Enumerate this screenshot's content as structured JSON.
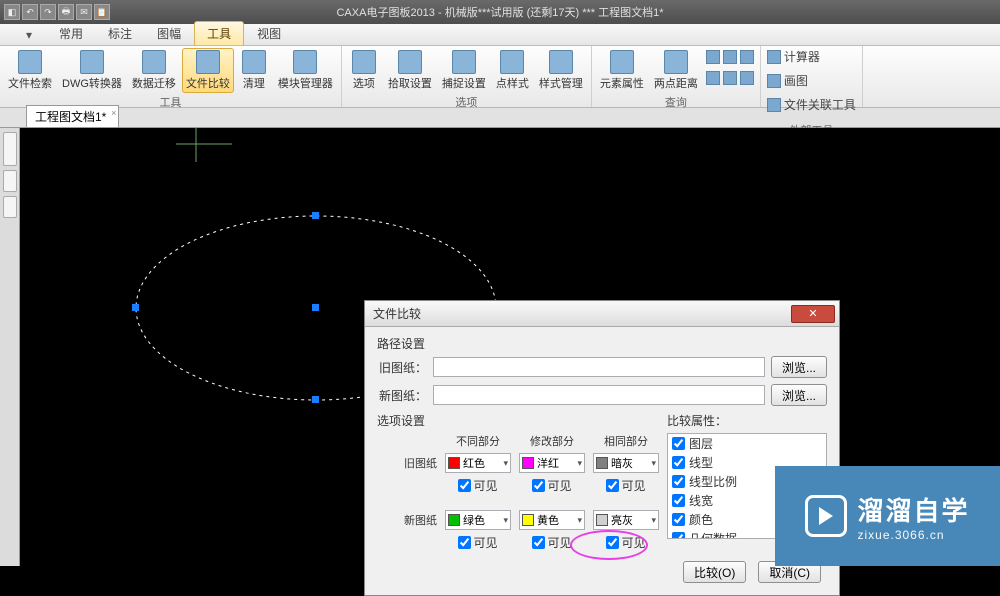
{
  "app": {
    "title": "CAXA电子图板2013 - 机械版***试用版 (还剩17天) ***   工程图文档1*"
  },
  "qat": [
    "↶",
    "↷",
    "🖶",
    "✉",
    "📋"
  ],
  "app_button": "◧",
  "tabs": {
    "items": [
      "常用",
      "标注",
      "图幅",
      "工具",
      "视图"
    ],
    "active_index": 3
  },
  "ribbon": {
    "groups": [
      {
        "label": "工具",
        "buttons": [
          {
            "label": "文件检索",
            "name": "file-search-button"
          },
          {
            "label": "DWG转换器",
            "name": "dwg-convert-button"
          },
          {
            "label": "数据迁移",
            "name": "data-migrate-button"
          },
          {
            "label": "文件比较",
            "name": "file-compare-button",
            "active": true
          },
          {
            "label": "清理",
            "name": "purge-button"
          },
          {
            "label": "模块管理器",
            "name": "module-mgr-button"
          }
        ]
      },
      {
        "label": "选项",
        "buttons": [
          {
            "label": "选项",
            "name": "options-button"
          },
          {
            "label": "拾取设置",
            "name": "pick-settings-button"
          },
          {
            "label": "捕捉设置",
            "name": "snap-settings-button"
          },
          {
            "label": "点样式",
            "name": "point-style-button"
          },
          {
            "label": "样式管理",
            "name": "style-mgr-button"
          }
        ]
      },
      {
        "label": "查询",
        "buttons": [
          {
            "label": "元素属性",
            "name": "elem-prop-button"
          },
          {
            "label": "两点距离",
            "name": "dist-button"
          }
        ],
        "small_stack": [
          "📐",
          "📏",
          "⌂",
          "◫",
          "◳",
          "◲"
        ]
      },
      {
        "label": "外部工具",
        "rows": [
          {
            "icon": "calc",
            "label": "计算器"
          },
          {
            "icon": "paint",
            "label": "画图"
          },
          {
            "icon": "link",
            "label": "文件关联工具"
          }
        ]
      }
    ]
  },
  "doc_tab": "工程图文档1*",
  "dialog": {
    "title": "文件比较",
    "path_section": "路径设置",
    "old_label": "旧图纸：",
    "new_label": "新图纸：",
    "browse": "浏览...",
    "opts_section": "选项设置",
    "headers": [
      "不同部分",
      "修改部分",
      "相同部分"
    ],
    "row_old": "旧图纸",
    "row_new": "新图纸",
    "visible": "可见",
    "colors": {
      "old": [
        {
          "hex": "#ff0000",
          "name": "红色"
        },
        {
          "hex": "#ff00ff",
          "name": "洋红"
        },
        {
          "hex": "#808080",
          "name": "暗灰"
        }
      ],
      "new": [
        {
          "hex": "#00c000",
          "name": "绿色"
        },
        {
          "hex": "#ffff00",
          "name": "黄色"
        },
        {
          "hex": "#d0d0d0",
          "name": "亮灰"
        }
      ]
    },
    "attr_label": "比较属性：",
    "attrs": [
      "图层",
      "线型",
      "线型比例",
      "线宽",
      "颜色",
      "几何数据"
    ],
    "compare_btn": "比较(O)",
    "cancel_btn": "取消(C)"
  },
  "watermark": {
    "big": "溜溜自学",
    "small": "zixue.3066.cn"
  }
}
